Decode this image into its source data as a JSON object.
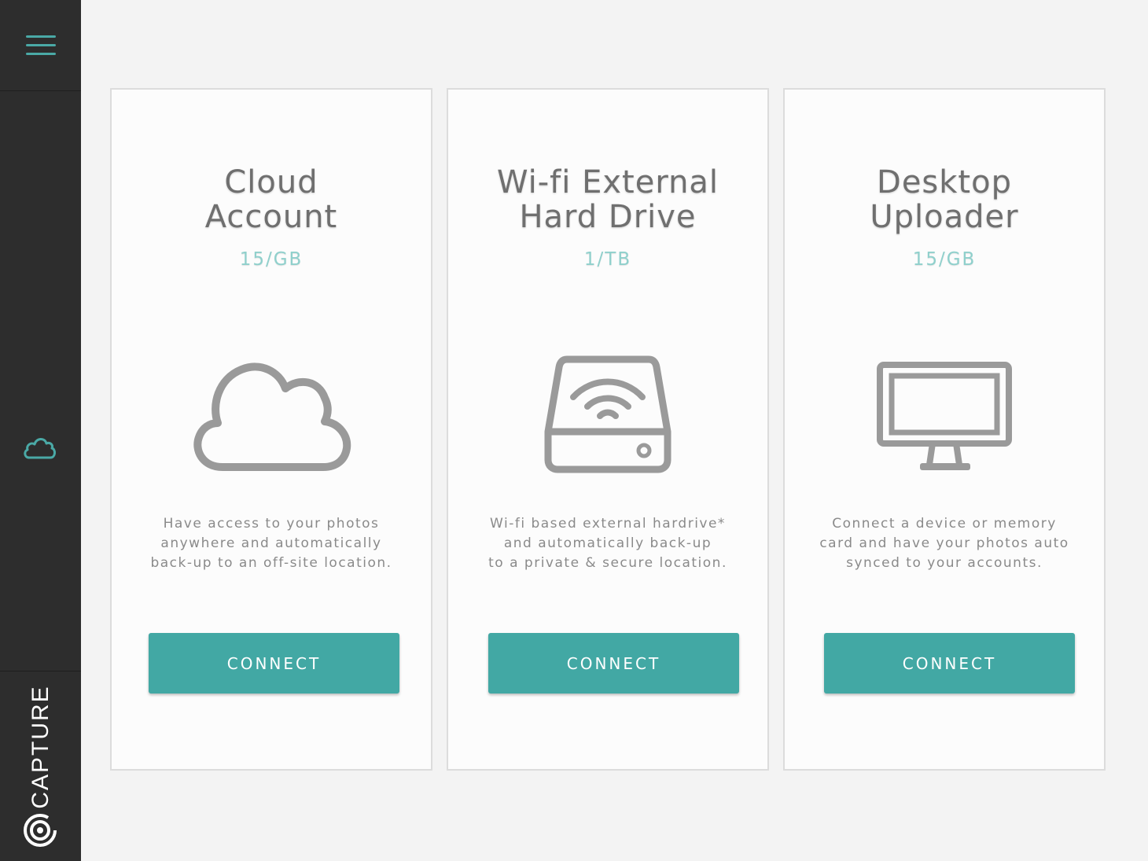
{
  "sidebar": {
    "menu_icon": "hamburger-menu-icon",
    "nav_icon": "cloud-icon",
    "brand": "CAPTURE",
    "brand_logo": "capture-logo-icon",
    "accent_color": "#4aa9a6",
    "background_color": "#2d2d2d"
  },
  "cards": [
    {
      "title_line1": "Cloud",
      "title_line2": "Account",
      "capacity": "15/GB",
      "icon": "cloud-icon",
      "desc_line1": "Have access to your photos",
      "desc_line2": "anywhere and automatically",
      "desc_line3": "back-up to an off-site location.",
      "button_label": "CONNECT"
    },
    {
      "title_line1": "Wi-fi External",
      "title_line2": "Hard Drive",
      "capacity": "1/TB",
      "icon": "wifi-hard-drive-icon",
      "desc_line1": "Wi-fi based external hardrive*",
      "desc_line2": "and automatically back-up",
      "desc_line3": "to a private & secure location.",
      "button_label": "CONNECT"
    },
    {
      "title_line1": "Desktop",
      "title_line2": "Uploader",
      "capacity": "15/GB",
      "icon": "desktop-monitor-icon",
      "desc_line1": "Connect a device or memory",
      "desc_line2": "card and have your photos auto",
      "desc_line3": "synced to your accounts.",
      "button_label": "CONNECT"
    }
  ],
  "colors": {
    "button": "#42a8a4",
    "capacity_text": "#8fd0cc",
    "title_text": "#6f6f6f",
    "icon_stroke": "#9a9a9a"
  }
}
